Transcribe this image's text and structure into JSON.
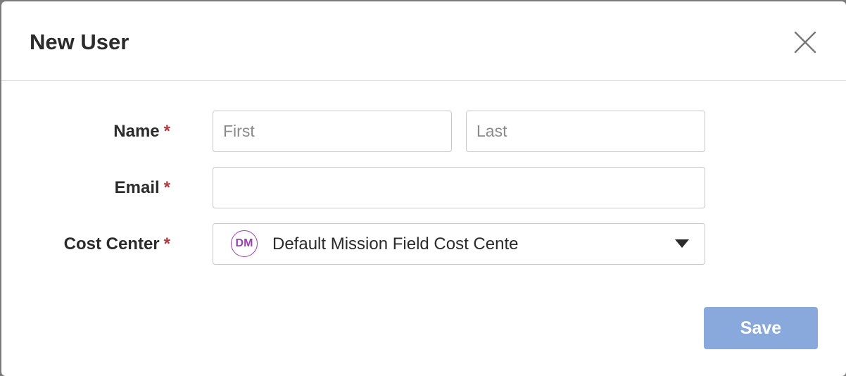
{
  "dialog": {
    "title": "New User",
    "close_icon": "close-icon"
  },
  "form": {
    "name": {
      "label": "Name",
      "required_mark": "*",
      "first_placeholder": "First",
      "first_value": "",
      "last_placeholder": "Last",
      "last_value": ""
    },
    "email": {
      "label": "Email",
      "required_mark": "*",
      "placeholder": "",
      "value": ""
    },
    "cost_center": {
      "label": "Cost Center",
      "required_mark": "*",
      "avatar_initials": "DM",
      "selected_value": "Default Mission Field Cost Cente",
      "dropdown_icon": "caret-down-icon"
    }
  },
  "actions": {
    "save_label": "Save"
  },
  "colors": {
    "required": "#b03a3a",
    "save_button": "#89a8db",
    "avatar_accent": "#9b3fb0"
  }
}
